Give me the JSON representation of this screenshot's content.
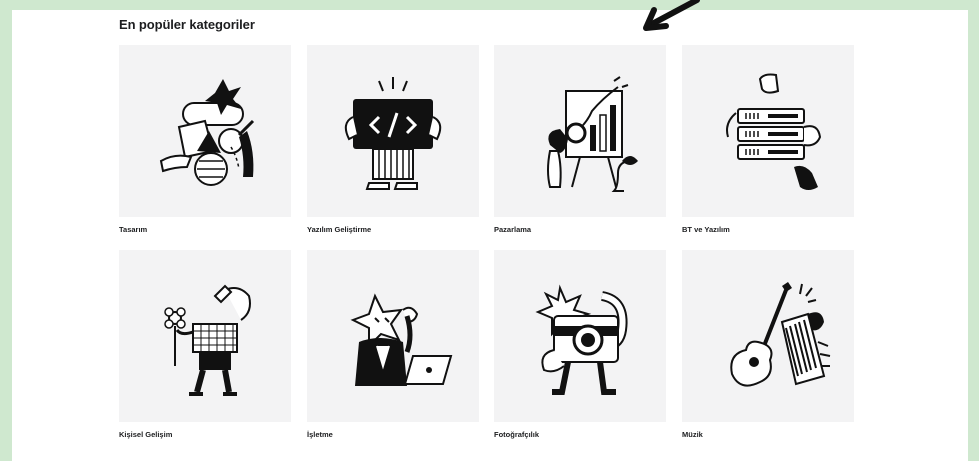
{
  "section": {
    "title": "En popüler kategoriler"
  },
  "categories": [
    {
      "label": "Tasarım",
      "icon": "design-illustration-icon"
    },
    {
      "label": "Yazılım Geliştirme",
      "icon": "code-illustration-icon"
    },
    {
      "label": "Pazarlama",
      "icon": "marketing-chart-icon"
    },
    {
      "label": "BT ve Yazılım",
      "icon": "server-rack-icon"
    },
    {
      "label": "Kişisel Gelişim",
      "icon": "personal-growth-icon"
    },
    {
      "label": "İşletme",
      "icon": "business-laptop-icon"
    },
    {
      "label": "Fotoğrafçılık",
      "icon": "camera-icon"
    },
    {
      "label": "Müzik",
      "icon": "guitar-piano-icon"
    }
  ],
  "colors": {
    "page_bg": "#cfe8cf",
    "panel_bg": "#ffffff",
    "thumb_bg": "#f3f3f4",
    "ink": "#1c1d1f"
  }
}
